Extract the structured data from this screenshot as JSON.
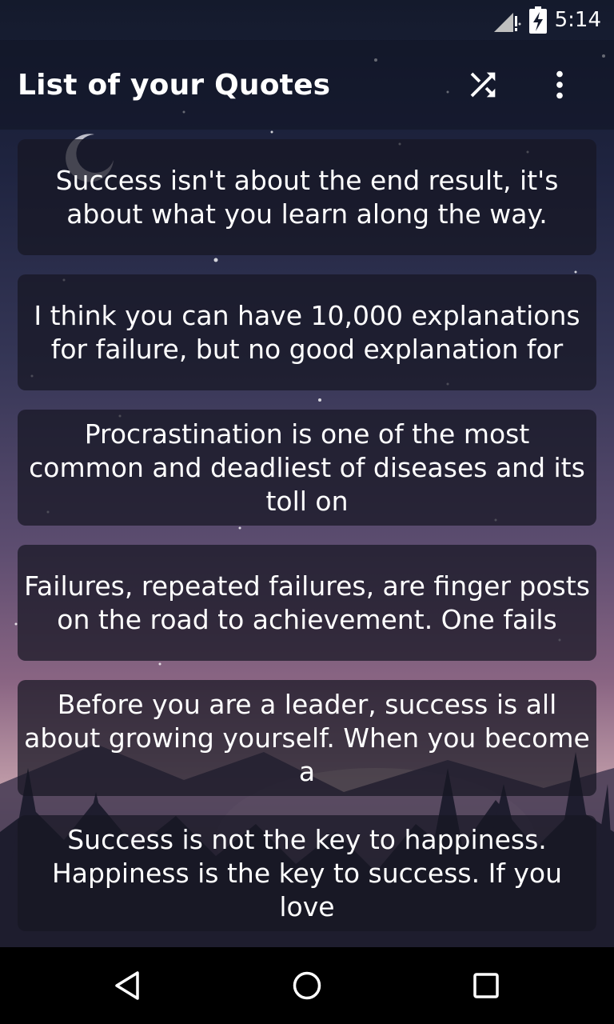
{
  "status_bar": {
    "time": "5:14",
    "icons": [
      "signal-icon",
      "battery-charging-icon"
    ]
  },
  "app_bar": {
    "title": "List of your Quotes",
    "actions": [
      "shuffle-icon",
      "more-vert-icon"
    ]
  },
  "quotes": [
    "Success isn't about the end result, it's about what you learn along the way.",
    "I think you can have 10,000 explanations for failure, but no good explanation for",
    "Procrastination is one of the most common and deadliest of diseases and its toll on",
    "Failures, repeated failures, are finger posts on the road to achievement. One fails",
    "Before you are a leader, success is all about growing yourself. When you become a",
    "Success is not the key to happiness. Happiness is the key to success. If you love"
  ],
  "nav_bar": {
    "buttons": [
      "back-icon",
      "home-icon",
      "recents-icon"
    ]
  },
  "colors": {
    "card_bg": "#1a1a28",
    "app_bar_bg": "#141a2c",
    "sunset": "#c4a0ab"
  }
}
